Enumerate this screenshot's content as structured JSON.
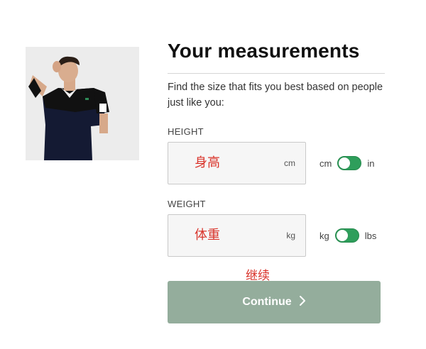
{
  "photo": {
    "alt": "model wearing polo shirt"
  },
  "heading": {
    "title": "Your measurements",
    "description": "Find the size that fits you best based on people just like you:"
  },
  "height": {
    "label": "HEIGHT",
    "value": "身高",
    "unit": "cm",
    "toggle": {
      "left": "cm",
      "right": "in",
      "selected": "cm"
    }
  },
  "weight": {
    "label": "WEIGHT",
    "value": "体重",
    "unit": "kg",
    "toggle": {
      "left": "kg",
      "right": "lbs",
      "selected": "kg"
    }
  },
  "annotation": "继续",
  "continue_button": {
    "label": "Continue",
    "icon": "chevron-right-icon"
  },
  "colors": {
    "accent": "#2e9e5b",
    "button": "#94ad9c",
    "annotation": "#d9342b"
  }
}
